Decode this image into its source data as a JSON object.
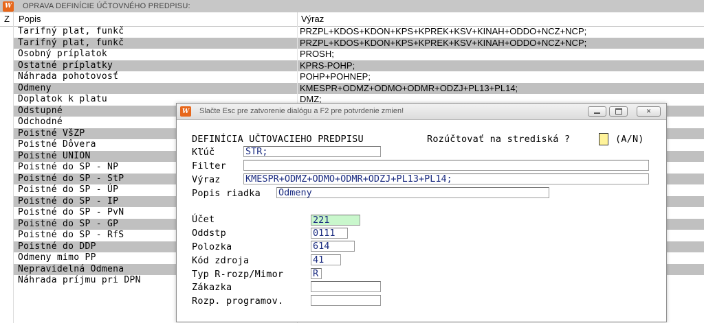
{
  "window": {
    "title": "OPRAVA DEFINÍCIE ÚČTOVNÉHO PREDPISU:"
  },
  "table": {
    "headers": {
      "z": "Z",
      "popis": "Popis",
      "vyraz": "Výraz"
    },
    "rows": [
      {
        "popis": "Tarifný plat, funkč",
        "vyraz": "PRZPL+KDOS+KDON+KPS+KPREK+KSV+KINAH+ODDO+NCZ+NCP;"
      },
      {
        "popis": "Tarifný plat, funkč",
        "vyraz": "PRZPL+KDOS+KDON+KPS+KPREK+KSV+KINAH+ODDO+NCZ+NCP;"
      },
      {
        "popis": "Osobný príplatok",
        "vyraz": "PROSH;"
      },
      {
        "popis": "Ostatné príplatky",
        "vyraz": "KPRS-POHP;"
      },
      {
        "popis": "Náhrada pohotovosť",
        "vyraz": "POHP+POHNEP;"
      },
      {
        "popis": "Odmeny",
        "vyraz": "KMESPR+ODMZ+ODMO+ODMR+ODZJ+PL13+PL14;"
      },
      {
        "popis": "Doplatok k platu",
        "vyraz": "DMZ;"
      },
      {
        "popis": "Odstupné",
        "vyraz": ""
      },
      {
        "popis": "Odchodné",
        "vyraz": ""
      },
      {
        "popis": "Poistné VšZP",
        "vyraz": ""
      },
      {
        "popis": "Poistné Dôvera",
        "vyraz": ""
      },
      {
        "popis": "Poistné UNION",
        "vyraz": ""
      },
      {
        "popis": "Poistné do SP - NP",
        "vyraz": ""
      },
      {
        "popis": "Poistné do SP - StP",
        "vyraz": ""
      },
      {
        "popis": "Poistné do SP - ÚP",
        "vyraz": ""
      },
      {
        "popis": "Poistné do SP - IP",
        "vyraz": ""
      },
      {
        "popis": "Poistné do SP - PvN",
        "vyraz": ""
      },
      {
        "popis": "Poistné do SP - GP",
        "vyraz": ""
      },
      {
        "popis": "Poistné do SP - RfS",
        "vyraz": ""
      },
      {
        "popis": "Poistné do DDP",
        "vyraz": ""
      },
      {
        "popis": "Odmeny mimo PP",
        "vyraz": ""
      },
      {
        "popis": "Nepravidelná Odmena",
        "vyraz": ""
      },
      {
        "popis": "Náhrada príjmu pri DPN",
        "vyraz": ""
      }
    ]
  },
  "dialog": {
    "title": "Slačte Esc pre zatvorenie dialógu a F2 pre potvrdenie zmien!",
    "heading": "DEFINÍCIA UČTOVACIEHO PREDPISU",
    "rozuctovat_label": "Rozúčtovať na strediská ?",
    "rozuctovat_value": "",
    "rozuctovat_hint": "(A/N)",
    "fields": {
      "kluc": {
        "label": "Kľúč",
        "value": "STR;"
      },
      "filter": {
        "label": "Filter",
        "value": ""
      },
      "vyraz": {
        "label": "Výraz",
        "value": "KMESPR+ODMZ+ODMO+ODMR+ODZJ+PL13+PL14;"
      },
      "popis": {
        "label": "Popis riadka",
        "value": "Odmeny"
      },
      "ucet": {
        "label": "Účet",
        "value": "221"
      },
      "oddstp": {
        "label": "Oddstp",
        "value": "0111"
      },
      "polozka": {
        "label": "Polozka",
        "value": "614"
      },
      "zdroj": {
        "label": "Kód zdroja",
        "value": "41"
      },
      "typ": {
        "label": "Typ R-rozp/Mimor",
        "value": "R"
      },
      "zakazka": {
        "label": "Zákazka",
        "value": ""
      },
      "rozp": {
        "label": "Rozp. programov.",
        "value": ""
      }
    }
  }
}
